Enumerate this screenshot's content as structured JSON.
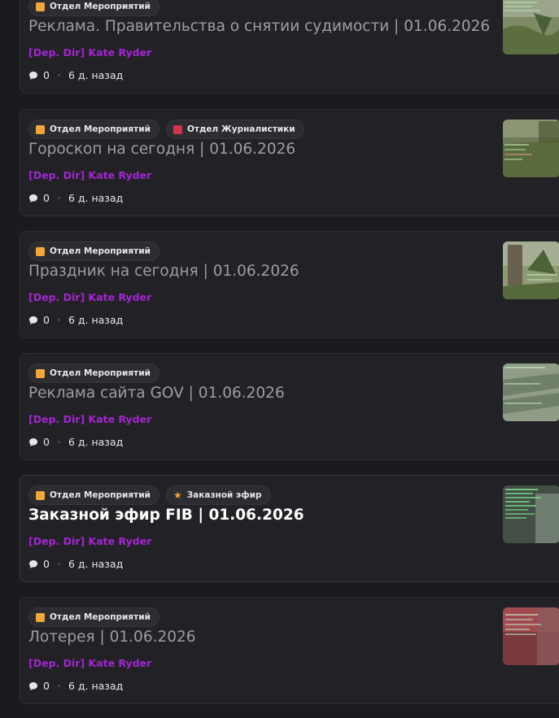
{
  "common": {
    "author": "[Dep. Dir] Kate Ryder",
    "comments": "0",
    "time": "6 д. назад"
  },
  "colors": {
    "author": "#a425d1",
    "tag_events": "#f1a73b",
    "tag_journalism": "#d8324a",
    "tag_star": "#f1a73b"
  },
  "posts": [
    {
      "tags": [
        {
          "label": "Отдел Мероприятий",
          "icon": "orange-square-icon"
        }
      ],
      "title": "Реклама. Правительства о снятии судимости | 01.06.2026",
      "unread": false
    },
    {
      "tags": [
        {
          "label": "Отдел Мероприятий",
          "icon": "orange-square-icon"
        },
        {
          "label": "Отдел Журналистики",
          "icon": "red-book-icon"
        }
      ],
      "title": "Гороскоп на сегодня | 01.06.2026",
      "unread": false
    },
    {
      "tags": [
        {
          "label": "Отдел Мероприятий",
          "icon": "orange-square-icon"
        }
      ],
      "title": "Праздник на сегодня | 01.06.2026",
      "unread": false
    },
    {
      "tags": [
        {
          "label": "Отдел Мероприятий",
          "icon": "orange-square-icon"
        }
      ],
      "title": "Реклама сайта GOV | 01.06.2026",
      "unread": false
    },
    {
      "tags": [
        {
          "label": "Отдел Мероприятий",
          "icon": "orange-square-icon"
        },
        {
          "label": "Заказной эфир",
          "icon": "star-icon"
        }
      ],
      "title": "Заказной эфир FIB | 01.06.2026",
      "unread": true
    },
    {
      "tags": [
        {
          "label": "Отдел Мероприятий",
          "icon": "orange-square-icon"
        }
      ],
      "title": "Лотерея | 01.06.2026",
      "unread": false
    }
  ]
}
